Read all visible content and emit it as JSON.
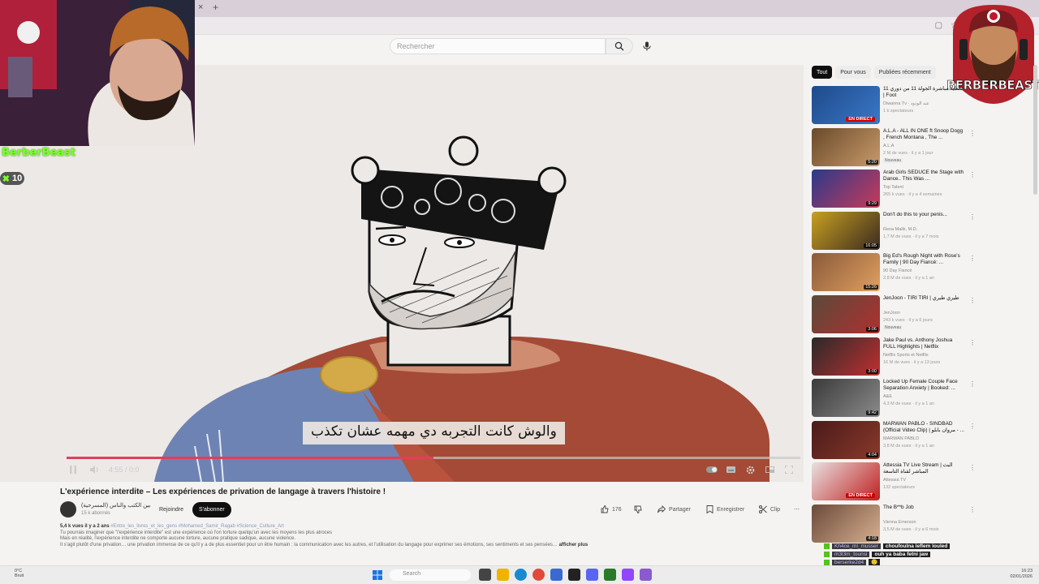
{
  "browser": {
    "tab_close": "×",
    "tab_new": "+"
  },
  "search": {
    "placeholder": "Rechercher"
  },
  "video": {
    "subtitle": "والوش كانت التجربه دي مهمه عشان تكذب",
    "time_label": "4:55 / 0:0",
    "progress": 0.5,
    "title": "L'expérience interdite – Les expériences de privation de langage à travers l'histoire !"
  },
  "channel": {
    "name": "بين الكتب والناس (المسرحية)",
    "subscribers": "15 k abonnés",
    "join_label": "Rejoindre",
    "subscribe_label": "S'abonner"
  },
  "actions": {
    "likes": "176",
    "share": "Partager",
    "save": "Enregistrer",
    "clip": "Clip",
    "more": "⋯"
  },
  "description": {
    "meta": "5,4 k vues  il y a 2 ans",
    "tags": "#Entre_les_livres_et_les_gens #Mohamed_Samir_Ragab #Science_Culture_Art",
    "line1": "Tu pourrais imaginer que \"l'expérience interdite\" est une expérience où l'on torture quelqu'un avec les moyens les plus atroces",
    "line2": "Mais en réalité, l'expérience interdite ne comporte aucune torture, aucune pratique sadique, aucune violence.",
    "line3": "Il s'agit plutôt d'une privation… une privation immense de ce qu'il y a de plus essentiel pour un être humain : la communication avec les autres, et l'utilisation du langage pour exprimer ses émotions, ses sentiments et ses pensées…",
    "more": "afficher plus"
  },
  "webcam": {
    "name": "BerberBeast",
    "count": "10",
    "count_icon": "✖"
  },
  "logo": {
    "text": "BERBERBEAST"
  },
  "chips": [
    "Tout",
    "Pour vous",
    "Publiées récemment"
  ],
  "recommendations": [
    {
      "title": "11 تغطية مباشرة الجولة 11 من دوري | Foot",
      "channel": "Diwanna Tv · عبد الودود",
      "meta": "1 k spectateurs",
      "badge": "EN DIRECT",
      "duration": "",
      "thumb_colors": [
        "#1e4a8a",
        "#3a78c8"
      ]
    },
    {
      "title": "A.L.A - ALL IN ONE ft Snoop Dogg , French Montana , The ...",
      "channel": "A.L.A",
      "meta": "2 M de vues · il y a 1 jour",
      "badge": "",
      "duration": "5:20",
      "tag": "Nouveau",
      "thumb_colors": [
        "#6a4a2a",
        "#c89a6a"
      ]
    },
    {
      "title": "Arab Girls SEDUCE the Stage with Dance.. This Was ...",
      "channel": "Top Talent",
      "meta": "265 k vues · il y a 4 semaines",
      "badge": "",
      "duration": "9:29",
      "thumb_colors": [
        "#2a3a8a",
        "#c83a5a"
      ]
    },
    {
      "title": "Don't do this to your penis...",
      "channel": "Rena Malik, M.D.",
      "meta": "1,7 M de vues · il y a 7 mois",
      "badge": "",
      "duration": "16:05",
      "thumb_colors": [
        "#c8a020",
        "#3a2a20"
      ]
    },
    {
      "title": "Big Ed's Rough Night with Rose's Family | 90 Day Fiancé: ...",
      "channel": "90 Day Fiancé",
      "meta": "2,8 M de vues · il y a 1 an",
      "badge": "",
      "duration": "15:26",
      "thumb_colors": [
        "#8a5a3a",
        "#e0a060"
      ]
    },
    {
      "title": "JenJoon - TIRI TIRI | طيري طيري",
      "channel": "JenJoon",
      "meta": "243 k vues · il y a 6 jours",
      "badge": "",
      "duration": "3:06",
      "tag": "Nouveau",
      "thumb_colors": [
        "#5a4a3a",
        "#b03030"
      ]
    },
    {
      "title": "Jake Paul vs. Anthony Joshua FULL Highlights | Netflix",
      "channel": "Netflix Sports et Netflix",
      "meta": "16 M de vues · il y a 13 jours",
      "badge": "",
      "duration": "3:00",
      "thumb_colors": [
        "#2a2a2a",
        "#c03030"
      ]
    },
    {
      "title": "Locked Up Female Couple Face Separation Anxiety | Booked: ...",
      "channel": "A&E",
      "meta": "4,3 M de vues · il y a 1 an",
      "badge": "",
      "duration": "9:42",
      "thumb_colors": [
        "#3a3a3a",
        "#8a8a8a"
      ]
    },
    {
      "title": "MARWAN PABLO - SINDBAD (Official Video Clip) | مروان بابلو - ...",
      "channel": "MARWAN PABLO",
      "meta": "3,8 M de vues · il y a 1 an",
      "badge": "",
      "duration": "4:04",
      "thumb_colors": [
        "#4a1a1a",
        "#8a3a2a"
      ]
    },
    {
      "title": "Attessia TV Live Stream | البث المباشر لقناة التاسعة",
      "channel": "Attessia TV",
      "meta": "132 spectateurs",
      "badge": "EN DIRECT",
      "duration": "",
      "thumb_colors": [
        "#e8e0e0",
        "#c02020"
      ]
    },
    {
      "title": "The B**b Job",
      "channel": "Vienna Emerson",
      "meta": "3,5 M de vues · il y a 6 mois",
      "badge": "",
      "duration": "4:18",
      "thumb_colors": [
        "#6a4a3a",
        "#d8b090"
      ]
    }
  ],
  "chat": [
    {
      "user": "Kh4ce_ml_musser",
      "message": "choufoulna leflem louled"
    },
    {
      "user": "m3l3m_tounsi",
      "message": "ouh ya baba fetni jaw"
    },
    {
      "user": "berserke2d4",
      "message": "🙂"
    }
  ],
  "taskbar": {
    "weather_temp": "0°C",
    "weather_desc": "Bruit",
    "search_label": "Search",
    "lang": "FRA",
    "time": "16:23",
    "date": "02/01/2026"
  }
}
